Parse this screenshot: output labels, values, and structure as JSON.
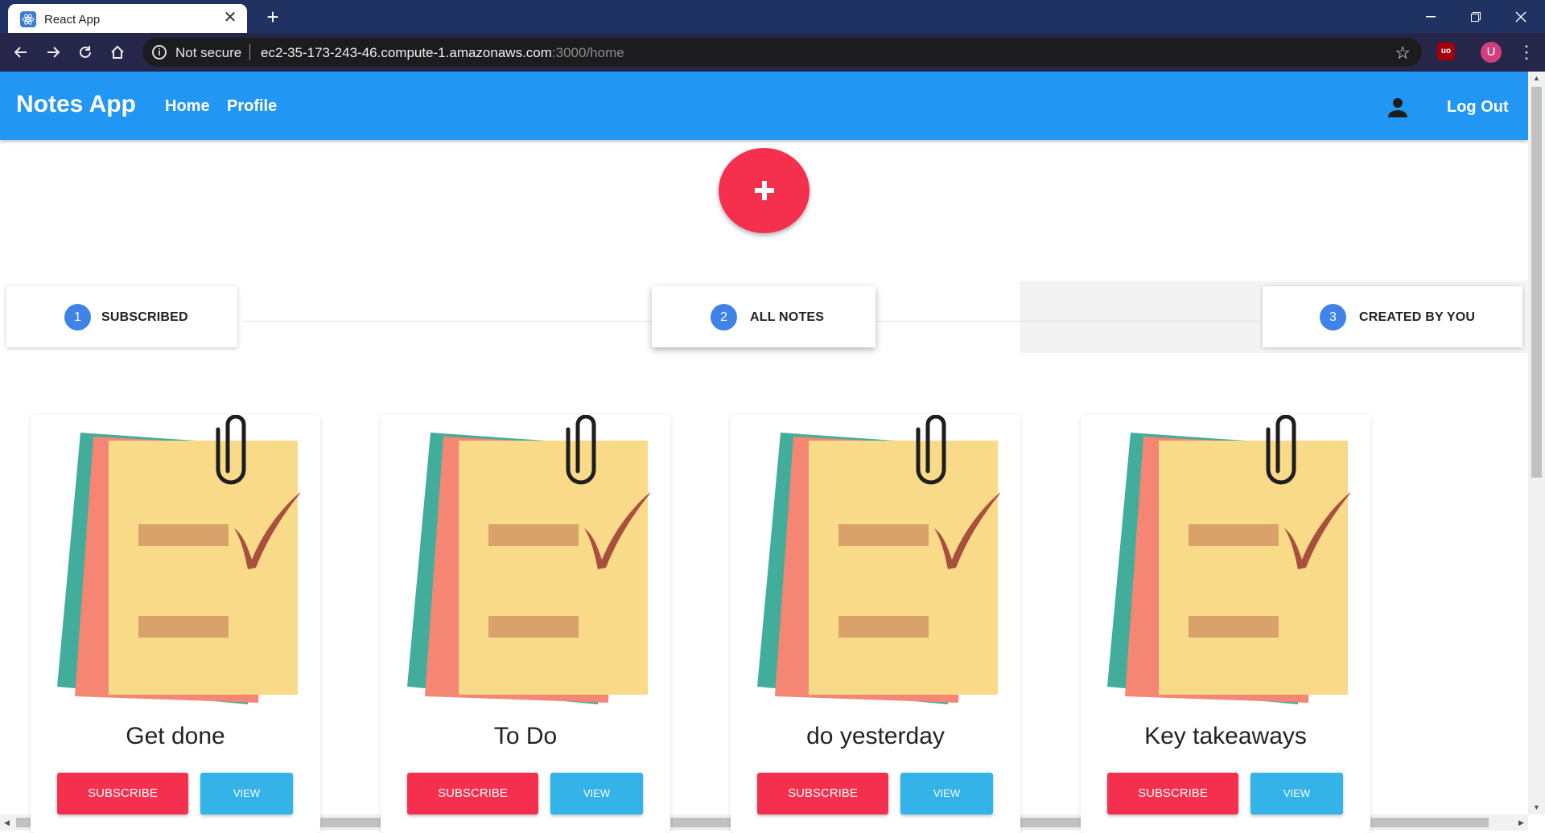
{
  "browser": {
    "tab_title": "React App",
    "tab_close": "✕",
    "new_tab": "+",
    "security": "Not secure",
    "url_host": "ec2-35-173-243-46.compute-1.amazonaws.com",
    "url_path": ":3000/home",
    "profile_initial": "U",
    "ext_label": "uo"
  },
  "appbar": {
    "title": "Notes App",
    "nav": [
      "Home",
      "Profile"
    ],
    "logout": "Log Out"
  },
  "fab": {
    "icon": "plus-icon"
  },
  "stepper": [
    {
      "num": "1",
      "label": "SUBSCRIBED",
      "active": false
    },
    {
      "num": "2",
      "label": "ALL NOTES",
      "active": true
    },
    {
      "num": "3",
      "label": "CREATED BY YOU",
      "active": false
    }
  ],
  "cards": [
    {
      "title": "Get done",
      "subscribe": "SUBSCRIBE",
      "view": "VIEW"
    },
    {
      "title": "To Do",
      "subscribe": "SUBSCRIBE",
      "view": "VIEW"
    },
    {
      "title": "do yesterday",
      "subscribe": "SUBSCRIBE",
      "view": "VIEW"
    },
    {
      "title": "Key takeaways",
      "subscribe": "SUBSCRIBE",
      "view": "VIEW"
    }
  ],
  "colors": {
    "appbar": "#2196f3",
    "accent": "#f5304e",
    "view_button": "#33b3e8",
    "step_circle": "#3f82e8"
  }
}
